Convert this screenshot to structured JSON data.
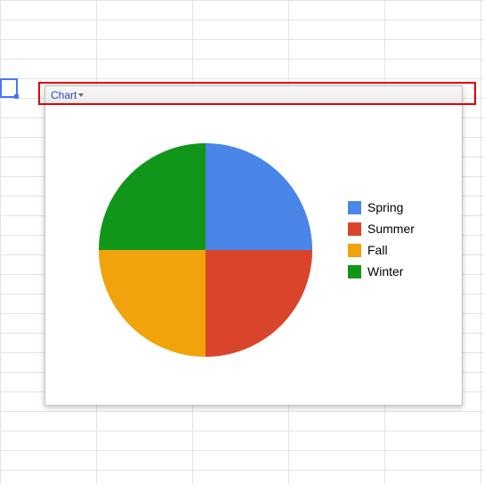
{
  "header": {
    "chart_dropdown_label": "Chart"
  },
  "chart_data": {
    "type": "pie",
    "title": "",
    "series": [
      {
        "name": "Spring",
        "value": 25,
        "color": "#4a86e8"
      },
      {
        "name": "Summer",
        "value": 25,
        "color": "#d9452b"
      },
      {
        "name": "Fall",
        "value": 25,
        "color": "#f0a30a"
      },
      {
        "name": "Winter",
        "value": 25,
        "color": "#109618"
      }
    ]
  }
}
